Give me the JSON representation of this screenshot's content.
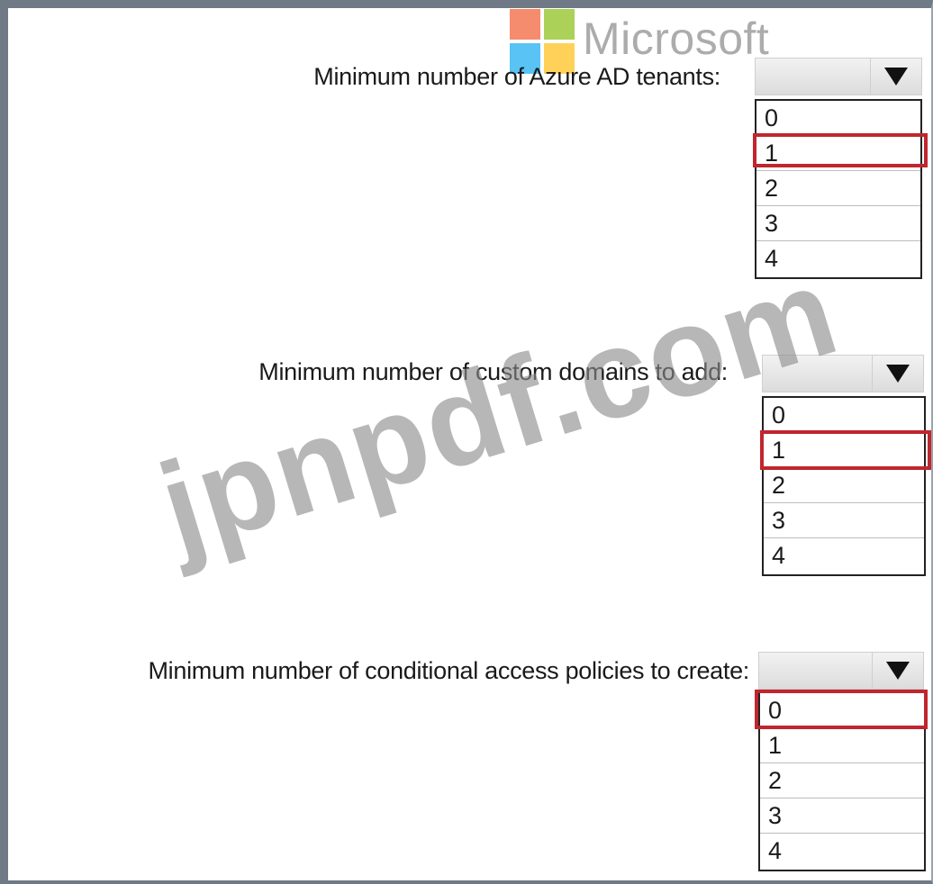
{
  "watermark": {
    "brand_text": "Microsoft",
    "site_text": "jpnpdf.com",
    "logo_colors": [
      "#f25022",
      "#7fba00",
      "#00a4ef",
      "#ffb900"
    ]
  },
  "highlight_color": "#c0262e",
  "questions": [
    {
      "label": "Minimum number of Azure AD tenants:",
      "selected_value": "",
      "options": [
        "0",
        "1",
        "2",
        "3",
        "4"
      ],
      "highlighted_option": "1"
    },
    {
      "label": "Minimum number of custom domains to add:",
      "selected_value": "",
      "options": [
        "0",
        "1",
        "2",
        "3",
        "4"
      ],
      "highlighted_option": "1"
    },
    {
      "label": "Minimum number of conditional access policies to create:",
      "selected_value": "",
      "options": [
        "0",
        "1",
        "2",
        "3",
        "4"
      ],
      "highlighted_option": "0"
    }
  ]
}
